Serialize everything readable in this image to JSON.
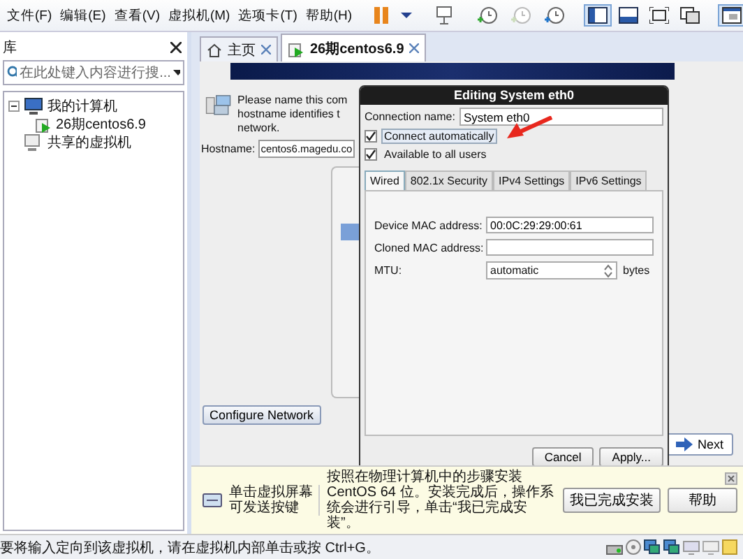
{
  "menu": [
    "文件(F)",
    "编辑(E)",
    "查看(V)",
    "虚拟机(M)",
    "选项卡(T)",
    "帮助(H)"
  ],
  "toolbar": [
    {
      "kind": "pause",
      "selected": false
    },
    {
      "kind": "caret",
      "selected": false
    },
    {
      "kind": "send",
      "selected": false
    },
    {
      "kind": "snapshot",
      "selected": false
    },
    {
      "kind": "revert",
      "selected": false
    },
    {
      "kind": "manager",
      "selected": false
    },
    {
      "kind": "sidebar",
      "selected": true
    },
    {
      "kind": "console",
      "selected": false
    },
    {
      "kind": "fullscreen",
      "selected": false
    },
    {
      "kind": "unity",
      "selected": false
    },
    {
      "kind": "thumbnail",
      "selected": true
    }
  ],
  "sidebar": {
    "title": "库",
    "search": {
      "placeholder": "在此处键入内容进行搜..."
    },
    "tree": [
      {
        "label": "我的计算机",
        "expanded": true,
        "children": [
          {
            "label": "26期centos6.9"
          }
        ]
      },
      {
        "label": "共享的虚拟机"
      }
    ]
  },
  "tabs": [
    {
      "label": "主页",
      "kind": "home",
      "selected": false
    },
    {
      "label": "26期centos6.9",
      "kind": "vm",
      "selected": true
    }
  ],
  "installer": {
    "intro_lines": [
      "Please name this com",
      "hostname identifies t",
      "network."
    ],
    "hostname_label": "Hostname:",
    "hostname_value": "centos6.magedu.co",
    "configure_button": "Configure Network",
    "next_button": "Next"
  },
  "dialog": {
    "title": "Editing System eth0",
    "connection_name_label": "Connection name:",
    "connection_name_value": "System eth0",
    "options": [
      {
        "label": "Connect automatically",
        "checked": true
      },
      {
        "label": "Available to all users",
        "checked": true
      }
    ],
    "tabs": [
      {
        "label": "Wired",
        "selected": true
      },
      {
        "label": "802.1x Security",
        "selected": false
      },
      {
        "label": "IPv4 Settings",
        "selected": false
      },
      {
        "label": "IPv6 Settings",
        "selected": false
      }
    ],
    "fields": [
      {
        "label": "Device MAC address:",
        "value": "00:0C:29:29:00:61",
        "kind": "text"
      },
      {
        "label": "Cloned MAC address:",
        "kind": "text"
      },
      {
        "label": "MTU:",
        "value": "automatic",
        "kind": "spin",
        "unit": "bytes"
      }
    ],
    "buttons": [
      "Cancel",
      "Apply..."
    ]
  },
  "hint_bar": {
    "lead_lines": [
      "单击虚拟屏幕",
      "可发送按键"
    ],
    "message": "按照在物理计算机中的步骤安装 CentOS 64 位。安装完成后，操作系统会进行引导，单击“我已完成安装”。",
    "buttons": [
      "我已完成安装",
      "帮助"
    ]
  },
  "status_bar": {
    "text": "要将输入定向到该虚拟机，请在虚拟机内部单击或按 Ctrl+G。"
  }
}
